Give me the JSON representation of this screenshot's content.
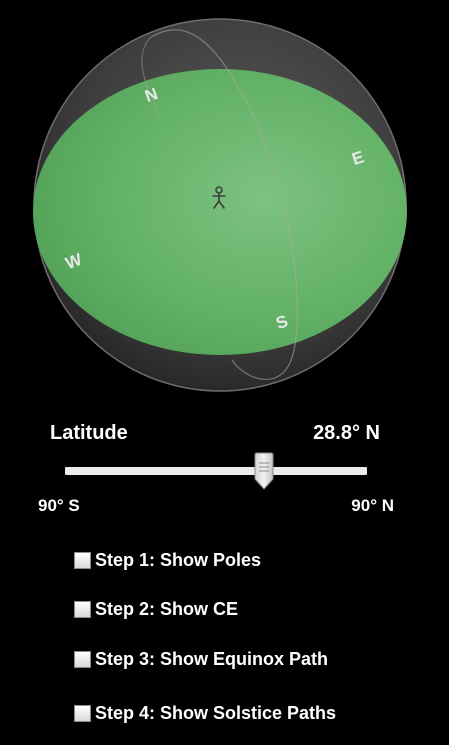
{
  "sphere": {
    "directions": {
      "north": "N",
      "east": "E",
      "south": "S",
      "west": "W"
    },
    "observer_icon": "person-icon",
    "colors": {
      "horizon_plane": "#5fb564",
      "sphere_shell": "#3a3a3a",
      "outline": "#8a8a8a"
    }
  },
  "latitude": {
    "label": "Latitude",
    "value_text": "28.8° N",
    "value_degrees": 28.8,
    "min_label": "90° S",
    "max_label": "90° N",
    "min": -90,
    "max": 90
  },
  "steps": [
    {
      "label": "Step 1: Show Poles",
      "checked": false
    },
    {
      "label": "Step 2: Show CE",
      "checked": false
    },
    {
      "label": "Step 3: Show Equinox Path",
      "checked": false
    },
    {
      "label": "Step 4: Show Solstice Paths",
      "checked": false
    }
  ]
}
